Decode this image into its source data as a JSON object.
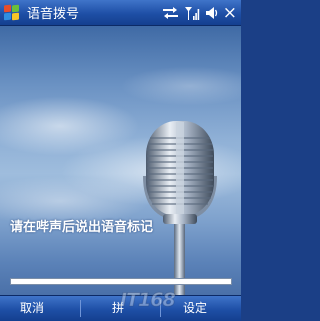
{
  "window": {
    "title": "语音拨号"
  },
  "status": {
    "icons": [
      "sync-arrows-icon",
      "signal-strength-icon",
      "speaker-icon",
      "close-icon"
    ],
    "close_glyph": "×"
  },
  "main": {
    "prompt": "请在哔声后说出语音标记",
    "progress": 0.0
  },
  "softkeys": {
    "left": "取消",
    "middle": "拼",
    "right": "设定"
  },
  "watermark": "IT168"
}
